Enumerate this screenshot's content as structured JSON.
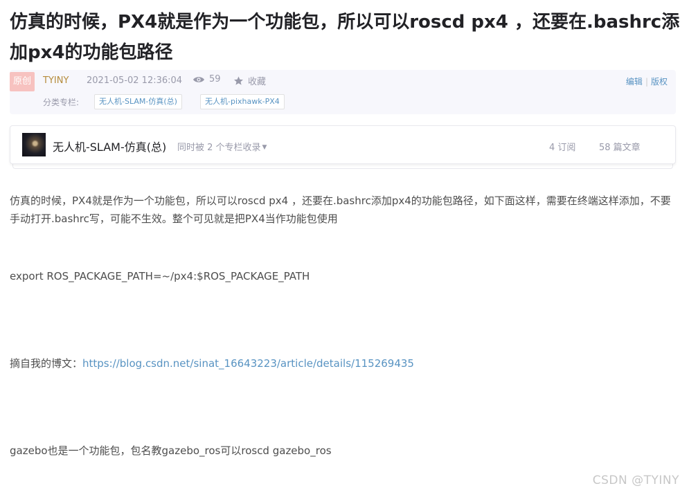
{
  "article": {
    "title": "仿真的时候，PX4就是作为一个功能包，所以可以roscd px4 ，还要在.bashrc添加px4的功能包路径"
  },
  "meta": {
    "badge": "原创",
    "author": "TYINY",
    "time": "2021-05-02 12:36:04",
    "views": "59",
    "favorite_label": "收藏",
    "edit_label": "编辑",
    "copyright_label": "版权",
    "category_label": "分类专栏:",
    "tags": [
      "无人机-SLAM-仿真(总)",
      "无人机-pixhawk-PX4"
    ]
  },
  "column": {
    "name": "无人机-SLAM-仿真(总)",
    "also_included": "同时被 2 个专栏收录",
    "subscribers": "4 订阅",
    "articles": "58 篇文章"
  },
  "body": {
    "p1": "仿真的时候，PX4就是作为一个功能包，所以可以roscd px4 ，还要在.bashrc添加px4的功能包路径，如下面这样，需要在终端这样添加，不要手动打开.bashrc写，可能不生效。整个可见就是把PX4当作功能包使用",
    "p2": "export ROS_PACKAGE_PATH=~/px4:$ROS_PACKAGE_PATH",
    "p3_prefix": "摘自我的博文：",
    "p3_link": "https://blog.csdn.net/sinat_16643223/article/details/115269435",
    "p4": "gazebo也是一个功能包，包名教gazebo_ros可以roscd gazebo_ros"
  },
  "watermark": "CSDN @TYINY",
  "colors": {
    "link": "#5893c2",
    "author": "#b58c3c",
    "badge_bg": "#f7c2c0",
    "meta_bg": "#f7f7fc"
  },
  "icons": [
    "eye-icon",
    "star-icon",
    "caret-down-icon",
    "column-avatar"
  ]
}
